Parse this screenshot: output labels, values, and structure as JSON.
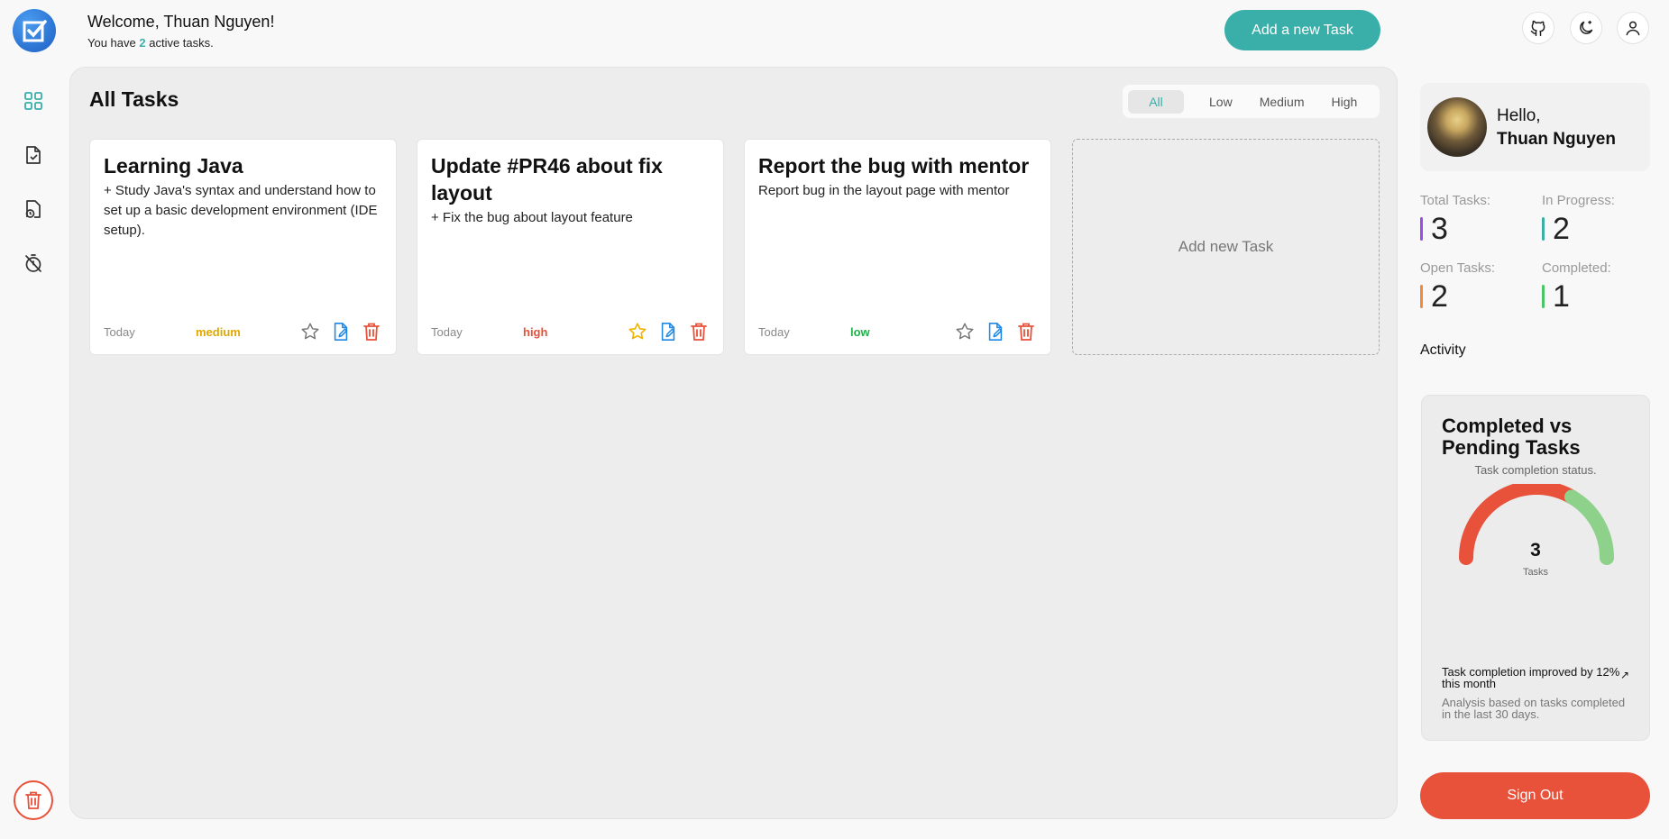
{
  "header": {
    "welcome": "Welcome, Thuan Nguyen!",
    "subtitle_prefix": "You have",
    "active_count": "2",
    "subtitle_suffix": "active tasks.",
    "add_task_label": "Add a new Task"
  },
  "main": {
    "title": "All Tasks",
    "filters": [
      "All",
      "Low",
      "Medium",
      "High"
    ],
    "active_filter": "All",
    "add_card_label": "Add new Task",
    "tasks": [
      {
        "title": "Learning Java",
        "description": "+ Study Java's syntax and understand how to set up a basic development environment (IDE setup).",
        "date": "Today",
        "priority": "medium",
        "priority_color": "#e0a800",
        "starred": false
      },
      {
        "title": "Update #PR46 about fix layout",
        "description": "+ Fix the bug about layout feature",
        "date": "Today",
        "priority": "high",
        "priority_color": "#e8513a",
        "starred": true
      },
      {
        "title": "Report the bug with mentor",
        "description": "Report bug in the layout page with mentor",
        "date": "Today",
        "priority": "low",
        "priority_color": "#22b04b",
        "starred": false
      }
    ]
  },
  "profile": {
    "greeting": "Hello,",
    "name": "Thuan Nguyen"
  },
  "stats": {
    "total_label": "Total Tasks:",
    "total": "3",
    "in_progress_label": "In Progress:",
    "in_progress": "2",
    "open_label": "Open Tasks:",
    "open": "2",
    "completed_label": "Completed:",
    "completed": "1",
    "colors": {
      "total": "#9b4fe0",
      "in_progress": "#3aafa9",
      "open": "#f08a3c",
      "completed": "#4cc46a"
    }
  },
  "activity": {
    "label": "Activity",
    "chart_title": "Completed vs Pending Tasks",
    "chart_subtitle": "Task completion status.",
    "total": "3",
    "unit": "Tasks",
    "trend": "Task completion improved by 12% this month",
    "note": "Analysis based on tasks completed in the last 30 days."
  },
  "chart_data": {
    "type": "pie",
    "categories": [
      "Pending",
      "Completed"
    ],
    "values": [
      2,
      1
    ],
    "colors": [
      "#e8513a",
      "#8dd18a"
    ]
  },
  "signout_label": "Sign Out",
  "icons": {
    "logo": "checkbox-logo-icon",
    "github": "github-icon",
    "theme": "moon-icon",
    "user": "user-icon"
  }
}
